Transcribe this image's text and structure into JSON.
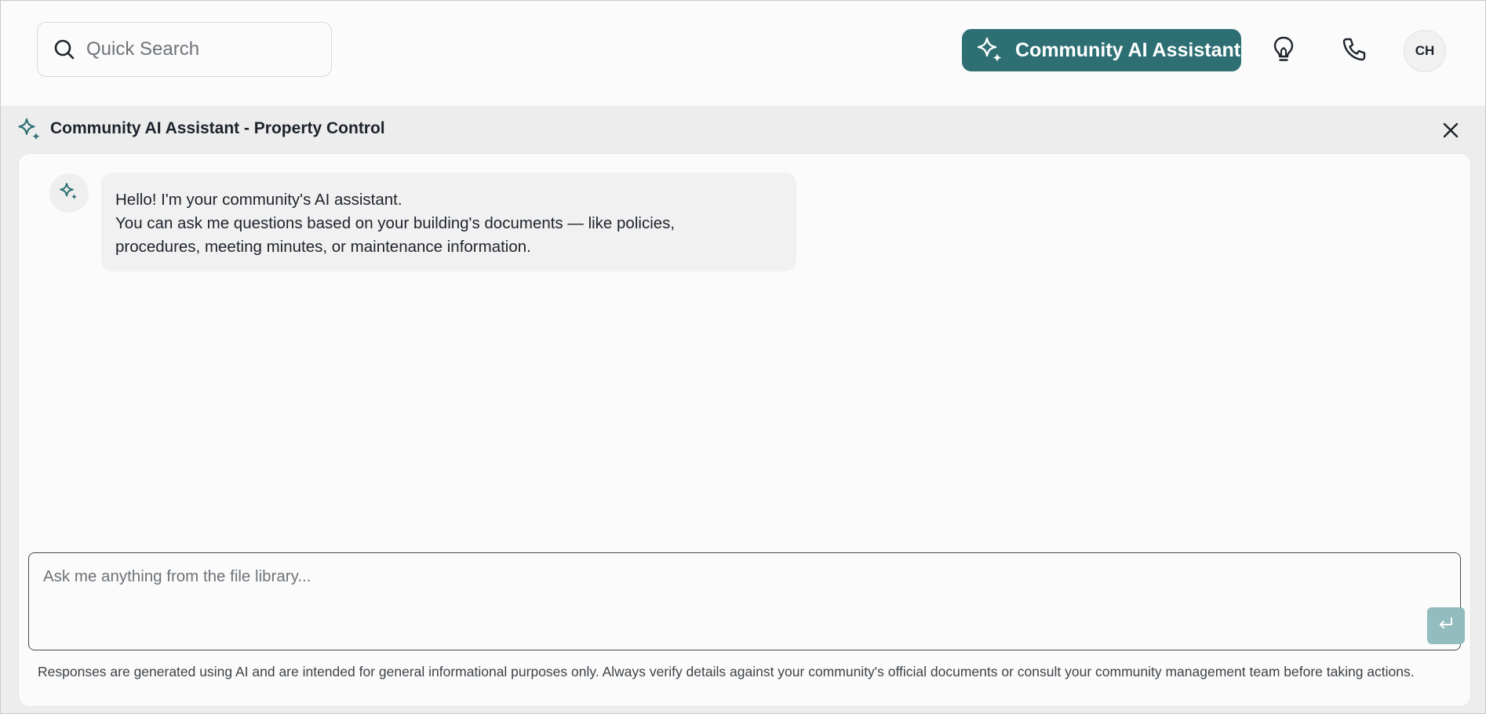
{
  "header": {
    "search": {
      "placeholder": "Quick Search",
      "value": ""
    },
    "ai_button_label": "Community AI Assistant",
    "avatar_initials": "CH",
    "icons": {
      "search": "search-icon",
      "sparkle": "sparkle-icon",
      "lightbulb": "lightbulb-icon",
      "phone": "phone-icon"
    }
  },
  "assistant_panel": {
    "title": "Community AI Assistant - Property Control",
    "messages": [
      {
        "role": "assistant",
        "lines": [
          "Hello! I'm your community's AI assistant.",
          "You can ask me questions based on your building's documents — like policies,",
          "procedures, meeting minutes, or maintenance information."
        ]
      }
    ],
    "input": {
      "placeholder": "Ask me anything from the file library...",
      "value": ""
    },
    "send_icon": "enter-icon",
    "disclaimer": "Responses are generated using AI and are intended for general informational purposes only. Always verify details against your community's official documents or consult your community management team before taking actions."
  },
  "colors": {
    "accent": "#2d6f73",
    "send_button_disabled": "#93bcbe",
    "panel_background": "#ededed",
    "bubble_background": "#f1f1f1"
  }
}
